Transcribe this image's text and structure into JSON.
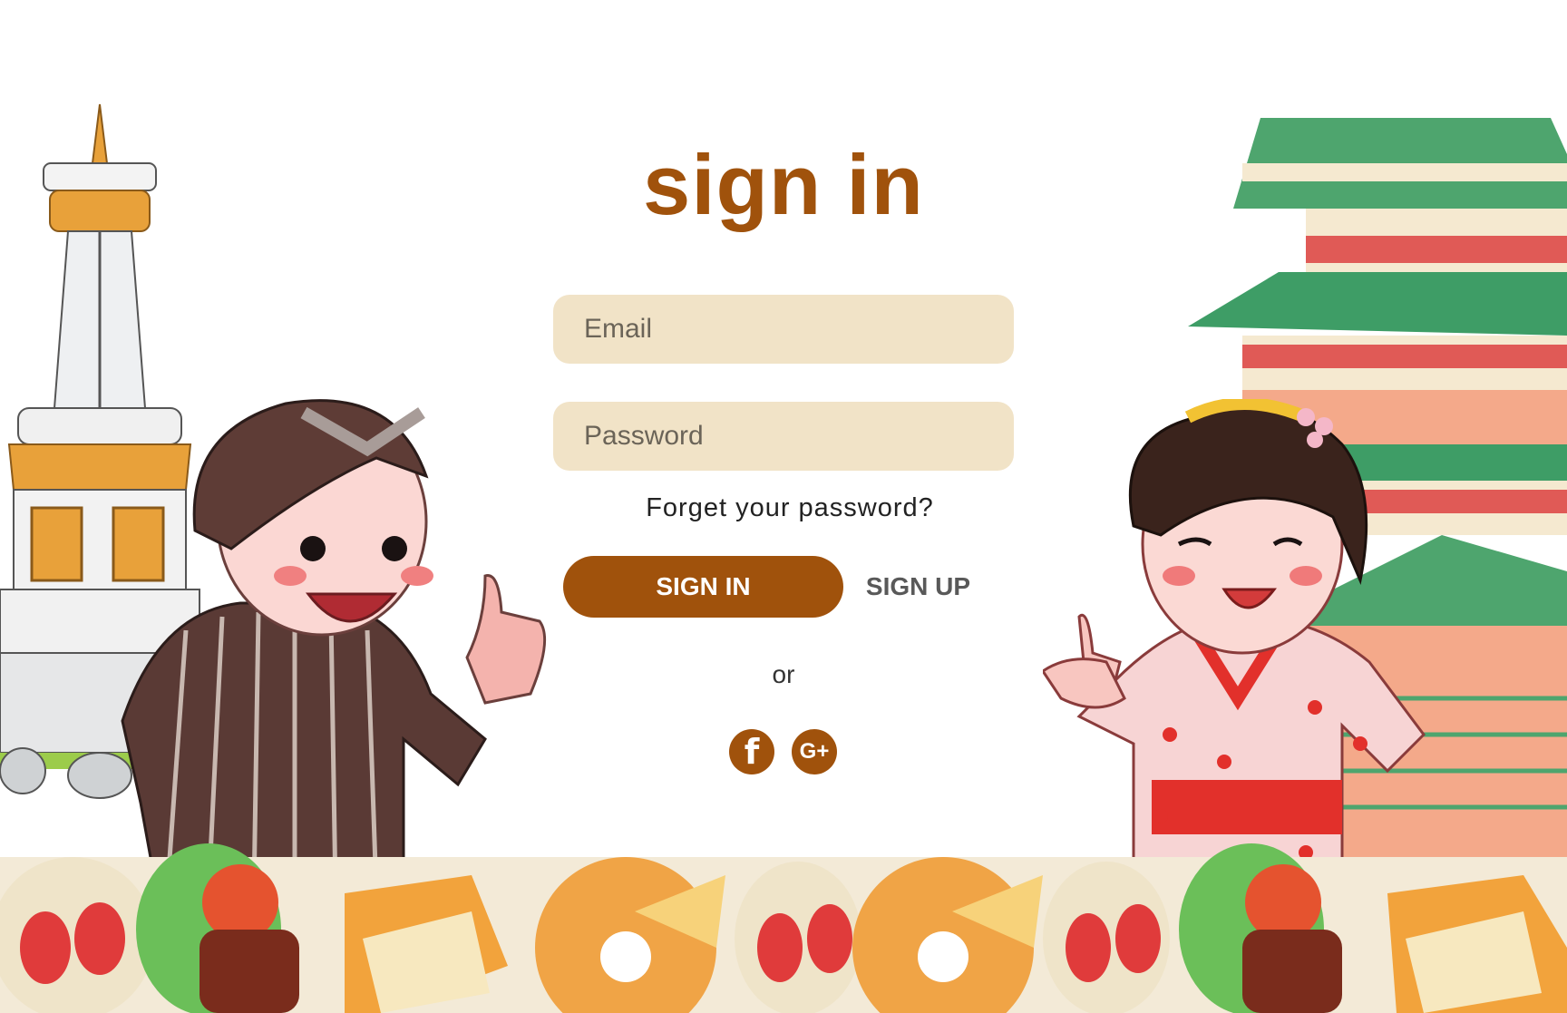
{
  "colors": {
    "brand_brown": "#A0520C",
    "input_bg": "#F1E3C7",
    "title": "#A0520C"
  },
  "form": {
    "title": "sign in",
    "email_placeholder": "Email",
    "password_placeholder": "Password",
    "forgot_label": "Forget your password?",
    "signin_label": "SIGN IN",
    "signup_label": "SIGN UP",
    "or_label": "or"
  },
  "social": {
    "facebook_icon": "facebook-icon",
    "facebook_glyph": "f",
    "google_icon": "google-plus-icon",
    "google_glyph": "G+"
  },
  "illustrations": {
    "left_monument": "tugu-monument-illustration",
    "left_character": "javanese-man-illustration",
    "right_building": "pagoda-illustration",
    "right_character": "kimono-woman-illustration",
    "bottom_banner": "food-banner-illustration"
  }
}
